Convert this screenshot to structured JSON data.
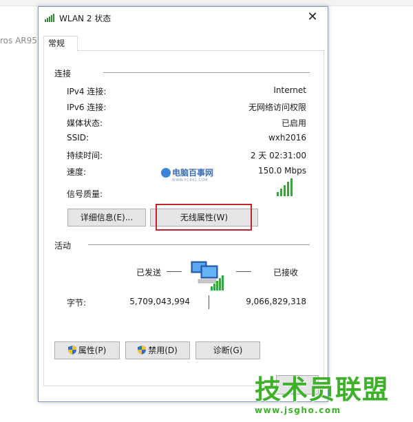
{
  "background": {
    "left_text": "ros AR95"
  },
  "window": {
    "title": "WLAN 2 状态",
    "close_glyph": "✕"
  },
  "tabs": [
    {
      "label": "常规"
    }
  ],
  "connection": {
    "section_label": "连接",
    "rows": [
      {
        "label": "IPv4 连接:",
        "value": "Internet"
      },
      {
        "label": "IPv6 连接:",
        "value": "无网络访问权限"
      },
      {
        "label": "媒体状态:",
        "value": "已启用"
      },
      {
        "label": "SSID:",
        "value": "wxh2016"
      },
      {
        "label": "持续时间:",
        "value": "2 天 02:31:00"
      },
      {
        "label": "速度:",
        "value": "150.0 Mbps"
      }
    ],
    "signal_label": "信号质量:",
    "signal_bars": 5,
    "details_button": "详细信息(E)...",
    "wireless_button": "无线属性(W)"
  },
  "activity": {
    "section_label": "活动",
    "sent_label": "已发送",
    "received_label": "已接收",
    "bytes_label": "字节:",
    "bytes_sent": "5,709,043,994",
    "bytes_received": "9,066,829,318"
  },
  "buttons": {
    "properties": "属性(P)",
    "disable": "禁用(D)",
    "diagnose": "诊断(G)"
  },
  "watermark_mid": {
    "text": "电脑百事网",
    "sub": "WWW.PC841.COM"
  },
  "watermark_br": {
    "text": "技术员联盟",
    "url": "www.jsgho.com"
  },
  "colors": {
    "accent_border": "#7a9cc9",
    "highlight": "#c0252b",
    "signal": "#3aa53a",
    "watermark": "#3fb02a"
  }
}
